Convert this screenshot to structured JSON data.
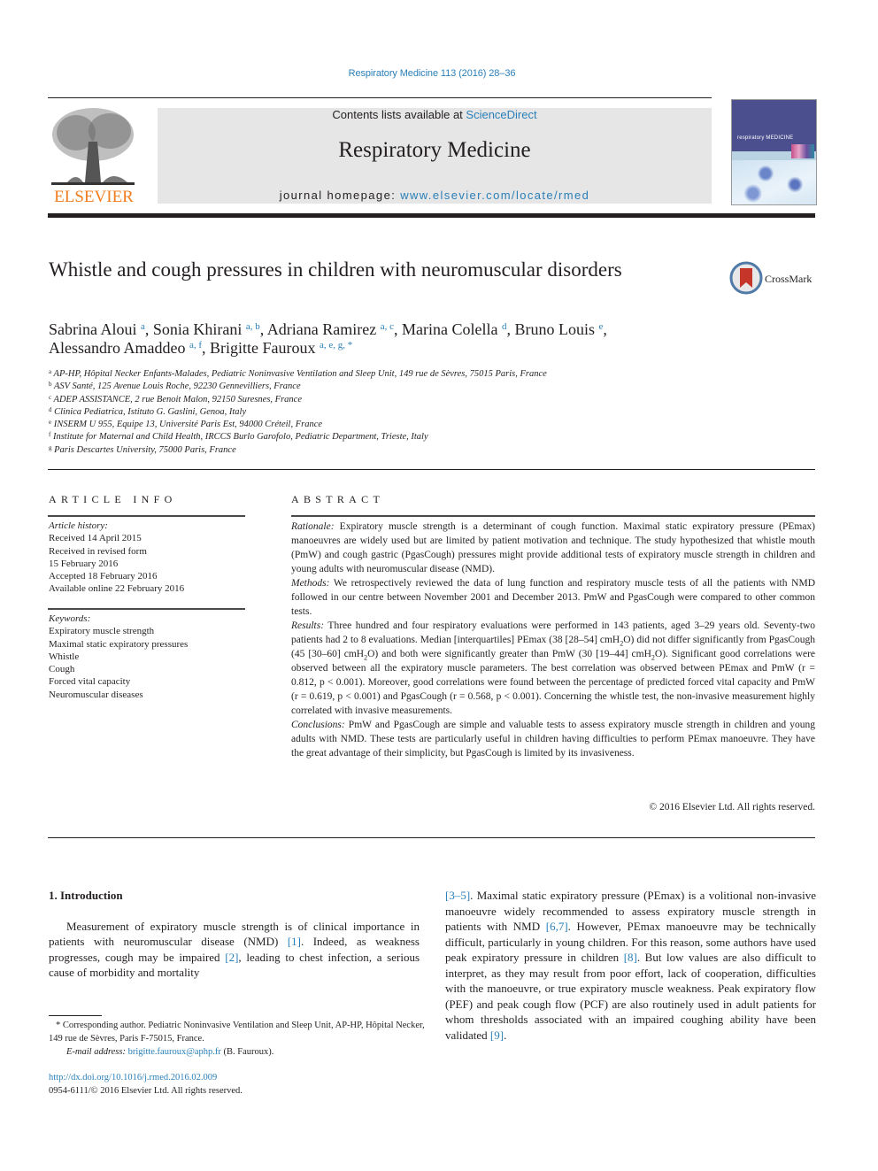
{
  "header": {
    "journal_ref": "Respiratory Medicine 113 (2016) 28–36",
    "contents_prefix": "Contents lists available at ",
    "contents_link": "ScienceDirect",
    "journal_name": "Respiratory Medicine",
    "homepage_prefix": "journal homepage: ",
    "homepage_link": "www.elsevier.com/locate/rmed",
    "publisher_logo_text": "ELSEVIER",
    "cover_title": "respiratory MEDICINE",
    "crossmark_label": "CrossMark",
    "colors": {
      "link": "#2a7fb8",
      "elsevier_orange": "#f07d1e",
      "banner_bg": "#e6e6e6",
      "cover_blue": "#4b4f8e"
    }
  },
  "article": {
    "title": "Whistle and cough pressures in children with neuromuscular disorders",
    "authors": [
      {
        "name": "Sabrina Aloui",
        "sup": "a",
        "sep": ", "
      },
      {
        "name": "Sonia Khirani",
        "sup": "a, b",
        "sep": ", "
      },
      {
        "name": "Adriana Ramirez",
        "sup": "a, c",
        "sep": ", "
      },
      {
        "name": "Marina Colella",
        "sup": "d",
        "sep": ", "
      },
      {
        "name": "Bruno Louis",
        "sup": "e",
        "sep": ","
      },
      {
        "name": "Alessandro Amaddeo",
        "sup": "a, f",
        "sep": ", "
      },
      {
        "name": "Brigitte Fauroux",
        "sup": "a, e, g, *",
        "sep": ""
      }
    ],
    "affiliations": [
      {
        "sup": "a",
        "text": "AP-HP, Hôpital Necker Enfants-Malades, Pediatric Noninvasive Ventilation and Sleep Unit, 149 rue de Sèvres, 75015 Paris, France"
      },
      {
        "sup": "b",
        "text": "ASV Santé, 125 Avenue Louis Roche, 92230 Gennevilliers, France"
      },
      {
        "sup": "c",
        "text": "ADEP ASSISTANCE, 2 rue Benoit Malon, 92150 Suresnes, France"
      },
      {
        "sup": "d",
        "text": "Clinica Pediatrica, Istituto G. Gaslini, Genoa, Italy"
      },
      {
        "sup": "e",
        "text": "INSERM U 955, Equipe 13, Université Paris Est, 94000 Créteil, France"
      },
      {
        "sup": "f",
        "text": "Institute for Maternal and Child Health, IRCCS Burlo Garofolo, Pediatric Department, Trieste, Italy"
      },
      {
        "sup": "g",
        "text": "Paris Descartes University, 75000 Paris, France"
      }
    ]
  },
  "article_info": {
    "heading": "ARTICLE INFO",
    "history_label": "Article history:",
    "history": [
      "Received 14 April 2015",
      "Received in revised form",
      "15 February 2016",
      "Accepted 18 February 2016",
      "Available online 22 February 2016"
    ],
    "keywords_label": "Keywords:",
    "keywords": [
      "Expiratory muscle strength",
      "Maximal static expiratory pressures",
      "Whistle",
      "Cough",
      "Forced vital capacity",
      "Neuromuscular diseases"
    ]
  },
  "abstract": {
    "heading": "ABSTRACT",
    "rationale_label": "Rationale:",
    "rationale": " Expiratory muscle strength is a determinant of cough function. Maximal static expiratory pressure (PEmax) manoeuvres are widely used but are limited by patient motivation and technique. The study hypothesized that whistle mouth (PmW) and cough gastric (PgasCough) pressures might provide additional tests of expiratory muscle strength in children and young adults with neuromuscular disease (NMD).",
    "methods_label": "Methods:",
    "methods": " We retrospectively reviewed the data of lung function and respiratory muscle tests of all the patients with NMD followed in our centre between November 2001 and December 2013. PmW and PgasCough were compared to other common tests.",
    "results_label": "Results:",
    "results_1": " Three hundred and four respiratory evaluations were performed in 143 patients, aged 3–29 years old. Seventy-two patients had 2 to 8 evaluations. Median [interquartiles] PEmax (38 [28–54] cmH",
    "results_2": "O) did not differ significantly from PgasCough (45 [30–60] cmH",
    "results_3": "O) and both were significantly greater than PmW (30 [19–44] cmH",
    "results_4": "O). Significant good correlations were observed between all the expiratory muscle parameters. The best correlation was observed between PEmax and PmW (r = 0.812, p < 0.001). Moreover, good correlations were found between the percentage of predicted forced vital capacity and PmW (r = 0.619, p < 0.001) and PgasCough (r = 0.568, p < 0.001). Concerning the whistle test, the non-invasive measurement highly correlated with invasive measurements.",
    "sub_2": "2",
    "conclusions_label": "Conclusions:",
    "conclusions": " PmW and PgasCough are simple and valuable tests to assess expiratory muscle strength in children and young adults with NMD. These tests are particularly useful in children having difficulties to perform PEmax manoeuvre. They have the great advantage of their simplicity, but PgasCough is limited by its invasiveness.",
    "copyright": "© 2016 Elsevier Ltd. All rights reserved."
  },
  "body": {
    "section_title": "1.  Introduction",
    "left": {
      "t1": "Measurement of expiratory muscle strength is of clinical importance in patients with neuromuscular disease (NMD) ",
      "r1": "[1]",
      "t2": ". Indeed, as weakness progresses, cough may be impaired ",
      "r2": "[2]",
      "t3": ", leading to chest infection, a serious cause of morbidity and mortality"
    },
    "right": {
      "r1": "[3–5]",
      "t1": ". Maximal static expiratory pressure (PEmax) is a volitional non-invasive manoeuvre widely recommended to assess expiratory muscle strength in patients with NMD ",
      "r2": "[6,7]",
      "t2": ". However, PEmax manoeuvre may be technically difficult, particularly in young children. For this reason, some authors have used peak expiratory pressure in children ",
      "r3": "[8]",
      "t3": ". But low values are also difficult to interpret, as they may result from poor effort, lack of cooperation, difficulties with the manoeuvre, or true expiratory muscle weakness. Peak expiratory flow (PEF) and peak cough flow (PCF) are also routinely used in adult patients for whom thresholds associated with an impaired coughing ability have been validated ",
      "r4": "[9]",
      "t4": "."
    }
  },
  "footnotes": {
    "corresponding": "* Corresponding author. Pediatric Noninvasive Ventilation and Sleep Unit, AP-HP, Hôpital Necker, 149 rue de Sèvres, Paris F-75015, France.",
    "email_label": "E-mail address:",
    "email": "brigitte.fauroux@aphp.fr",
    "email_suffix": " (B. Fauroux).",
    "doi": "http://dx.doi.org/10.1016/j.rmed.2016.02.009",
    "issn": "0954-6111/© 2016 Elsevier Ltd. All rights reserved."
  }
}
